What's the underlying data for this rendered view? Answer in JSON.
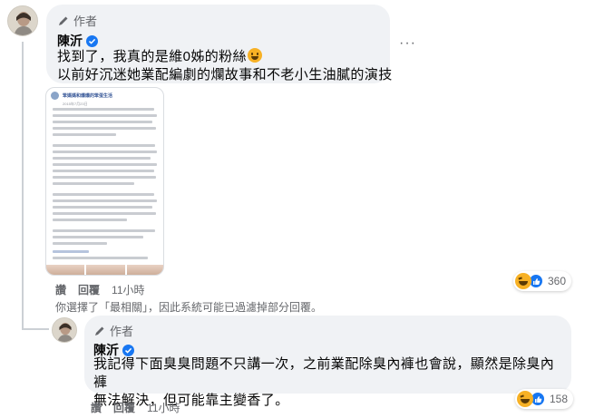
{
  "comments": [
    {
      "author_badge": "作者",
      "name": "陳沂",
      "text_line1": "找到了，我真的是維0姊的粉絲",
      "text_line2": "以前好沉迷她業配編劇的爛故事和不老小生油膩的演技",
      "actions": {
        "like": "讚",
        "reply": "回覆",
        "time": "11小時"
      },
      "reactions": {
        "types": [
          "haha-icon",
          "like-icon"
        ],
        "count": "360"
      }
    },
    {
      "author_badge": "作者",
      "name": "陳沂",
      "text_line1": "我記得下面臭臭問題不只講一次，之前業配除臭內褲也會說，顯然是除臭內褲",
      "text_line2": "無法解決，但可能靠主變香了。",
      "actions": {
        "like": "讚",
        "reply": "回覆",
        "time": "11小時"
      },
      "reactions": {
        "types": [
          "haha-icon",
          "like-icon"
        ],
        "count": "158"
      }
    }
  ],
  "filter_notice": "你選擇了「最相關」，因此系統可能已過濾掉部分回覆。",
  "attachment": {
    "page_name": "笨媽媽和爆爆的笨蛋生活",
    "date": "2015年7月23日"
  },
  "colors": {
    "bubble_bg": "#f0f2f5",
    "secondary_text": "#65676b",
    "verified_blue": "#1877f2",
    "haha_yellow": "#f7b125"
  }
}
